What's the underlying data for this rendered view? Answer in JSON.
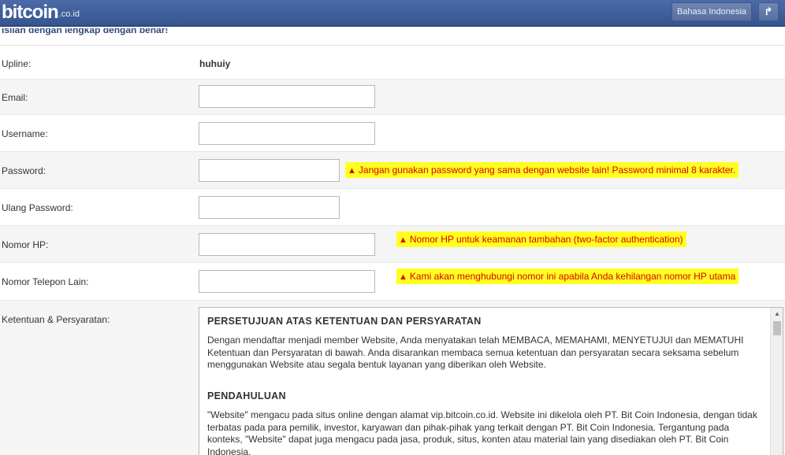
{
  "header": {
    "logo_main": "bitcoin",
    "logo_sub": ".co.id",
    "language_button": "Bahasa Indonesia",
    "logout_icon": "share-arrow-icon",
    "brand_color": "#3f5e9a"
  },
  "notice": "Isilah dengan lengkap dengan benar!",
  "form": {
    "upline_label": "Upline:",
    "upline_value": "huhuiy",
    "email_label": "Email:",
    "email_value": "",
    "username_label": "Username:",
    "username_value": "",
    "password_label": "Password:",
    "password_value": "",
    "password_warning": "Jangan gunakan password yang sama dengan website lain! Password minimal 8 karakter.",
    "repeat_password_label": "Ulang Password:",
    "repeat_password_value": "",
    "phone_label": "Nomor HP:",
    "phone_value": "",
    "phone_warning": "Nomor HP untuk keamanan tambahan (two-factor authentication)",
    "other_phone_label": "Nomor Telepon Lain:",
    "other_phone_value": "",
    "other_phone_warning": "Kami akan menghubungi nomor ini apabila Anda kehilangan nomor HP utama",
    "terms_label": "Ketentuan & Persyaratan:",
    "warning_color": "#ffff22"
  },
  "terms": {
    "heading1": "PERSETUJUAN ATAS KETENTUAN DAN PERSYARATAN",
    "p1": "Dengan mendaftar menjadi member Website, Anda menyatakan telah MEMBACA, MEMAHAMI, MENYETUJUI dan MEMATUHI Ketentuan dan Persyaratan di bawah. Anda disarankan membaca semua ketentuan dan persyaratan secara seksama sebelum menggunakan Website atau segala bentuk layanan yang diberikan oleh Website.",
    "heading2": "PENDAHULUAN",
    "p2": "\"Website\" mengacu pada situs online dengan alamat vip.bitcoin.co.id. Website ini dikelola oleh PT. Bit Coin Indonesia, dengan tidak terbatas pada para pemilik, investor, karyawan dan pihak-pihak yang terkait dengan PT. Bit Coin Indonesia. Tergantung pada konteks, \"Website\" dapat juga mengacu pada jasa, produk, situs, konten atau material lain yang disediakan oleh PT. Bit Coin Indonesia."
  }
}
